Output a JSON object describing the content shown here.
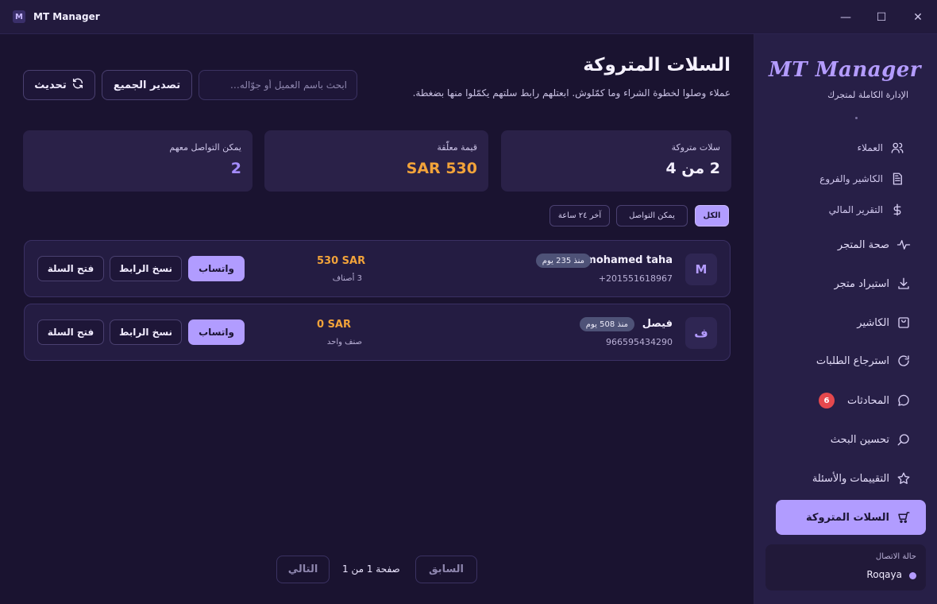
{
  "window": {
    "title": "MT Manager",
    "logo_letter": "M",
    "controls": {
      "minimize": "—",
      "maximize": "☐",
      "close": "✕"
    }
  },
  "sidebar": {
    "brand": "MT Manager",
    "subtitle": "الإدارة الكاملة لمتجرك",
    "items": [
      {
        "label": "العملاء",
        "icon": "users-icon"
      },
      {
        "label": "الكاشير والفروع",
        "icon": "document-icon"
      },
      {
        "label": "التقرير المالي",
        "icon": "dollar-icon"
      },
      {
        "label": "صحة المتجر",
        "icon": "pulse-icon"
      },
      {
        "label": "استيراد متجر",
        "icon": "download-icon"
      },
      {
        "label": "الكاشير",
        "icon": "bag-icon"
      },
      {
        "label": "استرجاع الطلبات",
        "icon": "refresh-icon"
      },
      {
        "label": "المحادثات",
        "icon": "chat-icon",
        "badge": "6"
      },
      {
        "label": "تحسين البحث",
        "icon": "search-icon"
      },
      {
        "label": "التقييمات والأسئلة",
        "icon": "star-icon"
      },
      {
        "label": "السلات المتروكة",
        "icon": "cart-icon",
        "active": true
      }
    ],
    "connection": {
      "label": "حالة الاتصال",
      "user": "Roqaya"
    }
  },
  "main": {
    "title": "السلات المتروكة",
    "description": "عملاء وصلوا لخطوة الشراء وما كمّلوش. ابعتلهم رابط سلتهم يكمّلوا منها بضغطة.",
    "search_placeholder": "ابحث باسم العميل أو جوّاله…",
    "export_label": "تصدير الجميع",
    "refresh_label": "تحديث",
    "stats": [
      {
        "label": "سلات متروكة",
        "value": "2 من 4"
      },
      {
        "label": "قيمة معلّقة",
        "value": "530 SAR"
      },
      {
        "label": "يمكن التواصل معهم",
        "value": "2"
      }
    ],
    "filters": [
      "الكل",
      "يمكن التواصل",
      "آخر ٢٤ ساعة"
    ],
    "carts": [
      {
        "avatar": "M",
        "name": "mohamed taha",
        "age": "منذ 235 يوم",
        "phone": "+201551618967",
        "amount": "530 SAR",
        "items": "3 أصناف"
      },
      {
        "avatar": "ف",
        "name": "فيصل",
        "age": "منذ 508 يوم",
        "phone": "966595434290",
        "amount": "0 SAR",
        "items": "صنف واحد"
      }
    ],
    "row_actions": {
      "whatsapp": "واتساب",
      "copy_link": "نسخ الرابط",
      "open_cart": "فتح السلة"
    },
    "pagination": {
      "prev": "السابق",
      "info": "صفحة 1 من 1",
      "next": "التالي"
    }
  },
  "colors": {
    "accent": "#b19cff",
    "amount": "#f2a33a",
    "badge": "#e5484d",
    "background": "#1a1330",
    "sidebar": "#271f47"
  }
}
